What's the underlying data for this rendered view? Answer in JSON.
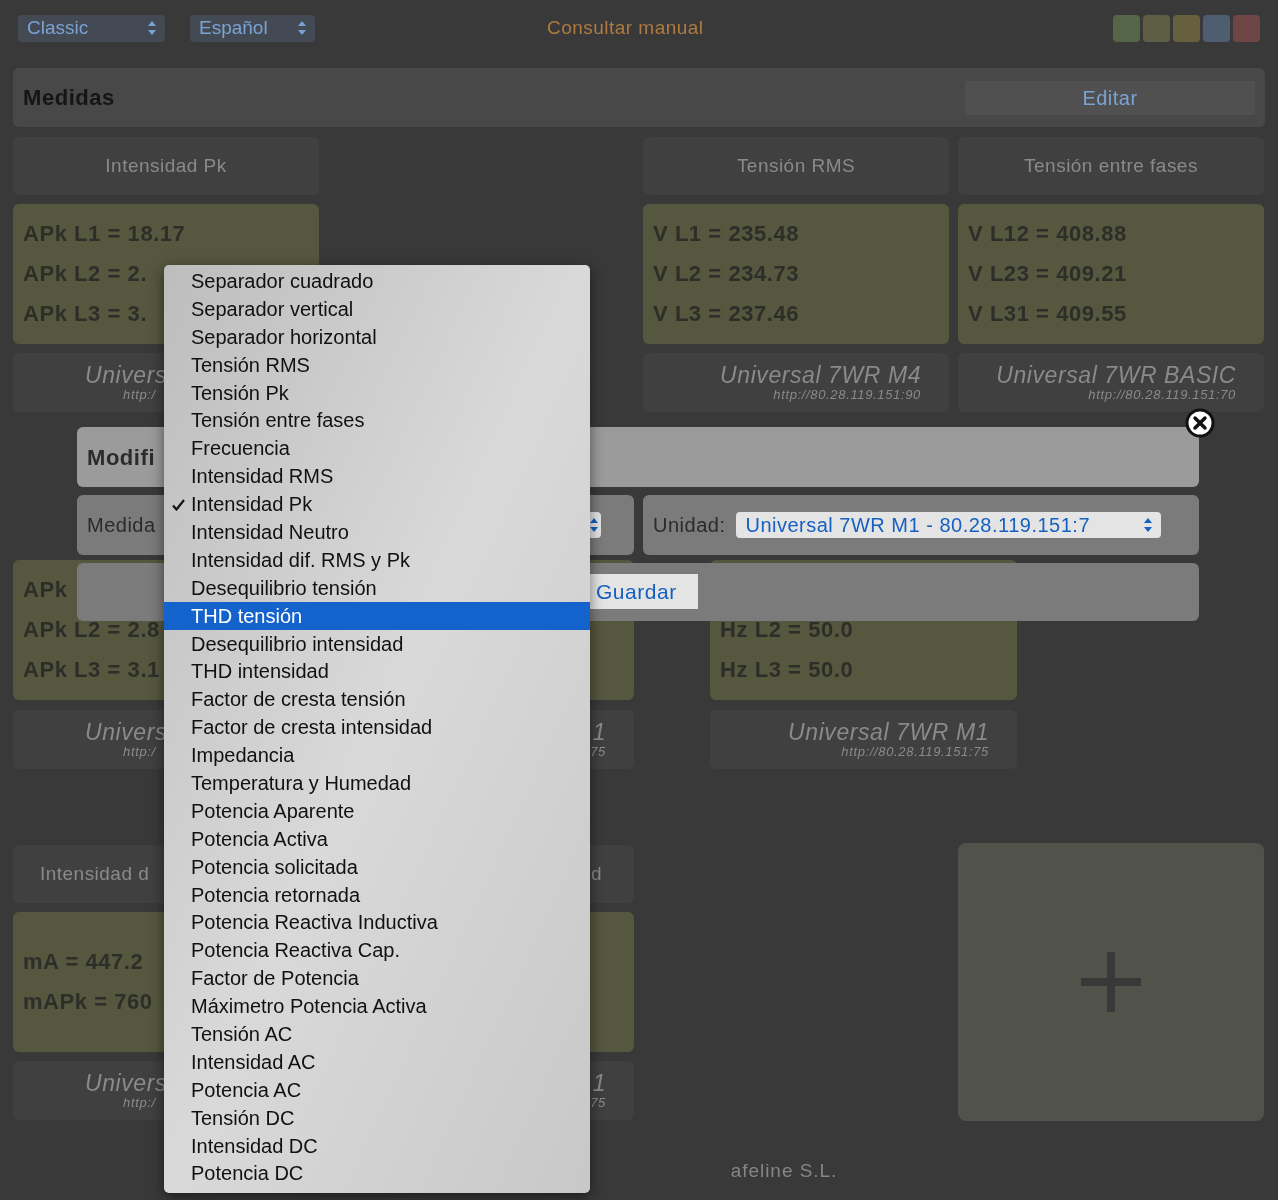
{
  "top_bar": {
    "theme_select": "Classic",
    "language_select": "Español",
    "manual_link": "Consultar manual",
    "swatches": [
      {
        "color": "#55654a"
      },
      {
        "color": "#5e5e45"
      },
      {
        "color": "#66603f"
      },
      {
        "color": "#4f5d70"
      },
      {
        "color": "#6e4646"
      }
    ]
  },
  "section": {
    "title": "Medidas",
    "edit_button": "Editar"
  },
  "row_1": {
    "tiles": [
      {
        "header": "Intensidad Pk",
        "lines": [
          "APk L1 = 18.17",
          "APk L2 = 2.",
          "APk L3 = 3."
        ],
        "unit": "Univers",
        "url": "http:/"
      },
      {
        "header": "Tensión RMS",
        "lines": [
          "V L1 = 235.48",
          "V L2 = 234.73",
          "V L3 = 237.46"
        ],
        "unit": "Universal 7WR M4",
        "url": "http://80.28.119.151:90"
      },
      {
        "header": "Tensión entre fases",
        "lines": [
          "V L12 = 408.88",
          "V L23 = 409.21",
          "V L31 = 409.55"
        ],
        "unit": "Universal 7WR BASIC",
        "url": "http://80.28.119.151:70"
      }
    ]
  },
  "row_2": {
    "tiles": [
      {
        "lines": [
          "APk",
          "APk L2 = 2.8",
          "APk L3 = 3.1"
        ],
        "unit": "Univers",
        "url": "http:/"
      },
      {
        "unit": "1",
        "url": "75"
      },
      {
        "lines": [
          "Hz L2 = 50.0",
          "Hz L3 = 50.0"
        ],
        "unit": "Universal 7WR M1",
        "url": "http://80.28.119.151:75"
      }
    ]
  },
  "row_3": {
    "tiles": [
      {
        "header": "Intensidad d",
        "lines": [
          "mA = 447.2",
          "mAPk = 760"
        ],
        "unit": "Univers",
        "url": "http:/"
      },
      {
        "header": "d",
        "unit": "1",
        "url": "75"
      }
    ]
  },
  "footer": "afeline S.L.",
  "modal": {
    "title": "Modifi",
    "measure_label": "Medida",
    "unit_label": "Unidad:",
    "unit_select": "Universal 7WR M1 - 80.28.119.151:7",
    "save_button": "Guardar"
  },
  "menu": {
    "items": [
      {
        "label": "Separador cuadrado",
        "checked": false,
        "highlighted": false
      },
      {
        "label": "Separador vertical",
        "checked": false,
        "highlighted": false
      },
      {
        "label": "Separador horizontal",
        "checked": false,
        "highlighted": false
      },
      {
        "label": "Tensión RMS",
        "checked": false,
        "highlighted": false
      },
      {
        "label": "Tensión Pk",
        "checked": false,
        "highlighted": false
      },
      {
        "label": "Tensión entre fases",
        "checked": false,
        "highlighted": false
      },
      {
        "label": "Frecuencia",
        "checked": false,
        "highlighted": false
      },
      {
        "label": "Intensidad RMS",
        "checked": false,
        "highlighted": false
      },
      {
        "label": "Intensidad Pk",
        "checked": true,
        "highlighted": false
      },
      {
        "label": "Intensidad Neutro",
        "checked": false,
        "highlighted": false
      },
      {
        "label": "Intensidad dif. RMS y Pk",
        "checked": false,
        "highlighted": false
      },
      {
        "label": "Desequilibrio tensión",
        "checked": false,
        "highlighted": false
      },
      {
        "label": "THD tensión",
        "checked": false,
        "highlighted": true
      },
      {
        "label": "Desequilibrio intensidad",
        "checked": false,
        "highlighted": false
      },
      {
        "label": "THD intensidad",
        "checked": false,
        "highlighted": false
      },
      {
        "label": "Factor de cresta tensión",
        "checked": false,
        "highlighted": false
      },
      {
        "label": "Factor de cresta intensidad",
        "checked": false,
        "highlighted": false
      },
      {
        "label": "Impedancia",
        "checked": false,
        "highlighted": false
      },
      {
        "label": "Temperatura y Humedad",
        "checked": false,
        "highlighted": false
      },
      {
        "label": "Potencia Aparente",
        "checked": false,
        "highlighted": false
      },
      {
        "label": "Potencia Activa",
        "checked": false,
        "highlighted": false
      },
      {
        "label": "Potencia solicitada",
        "checked": false,
        "highlighted": false
      },
      {
        "label": "Potencia retornada",
        "checked": false,
        "highlighted": false
      },
      {
        "label": "Potencia Reactiva Inductiva",
        "checked": false,
        "highlighted": false
      },
      {
        "label": "Potencia Reactiva Cap.",
        "checked": false,
        "highlighted": false
      },
      {
        "label": "Factor de Potencia",
        "checked": false,
        "highlighted": false
      },
      {
        "label": "Máximetro Potencia Activa",
        "checked": false,
        "highlighted": false
      },
      {
        "label": "Tensión AC",
        "checked": false,
        "highlighted": false
      },
      {
        "label": "Intensidad AC",
        "checked": false,
        "highlighted": false
      },
      {
        "label": "Potencia AC",
        "checked": false,
        "highlighted": false
      },
      {
        "label": "Tensión DC",
        "checked": false,
        "highlighted": false
      },
      {
        "label": "Intensidad DC",
        "checked": false,
        "highlighted": false
      },
      {
        "label": "Potencia DC",
        "checked": false,
        "highlighted": false
      }
    ]
  }
}
